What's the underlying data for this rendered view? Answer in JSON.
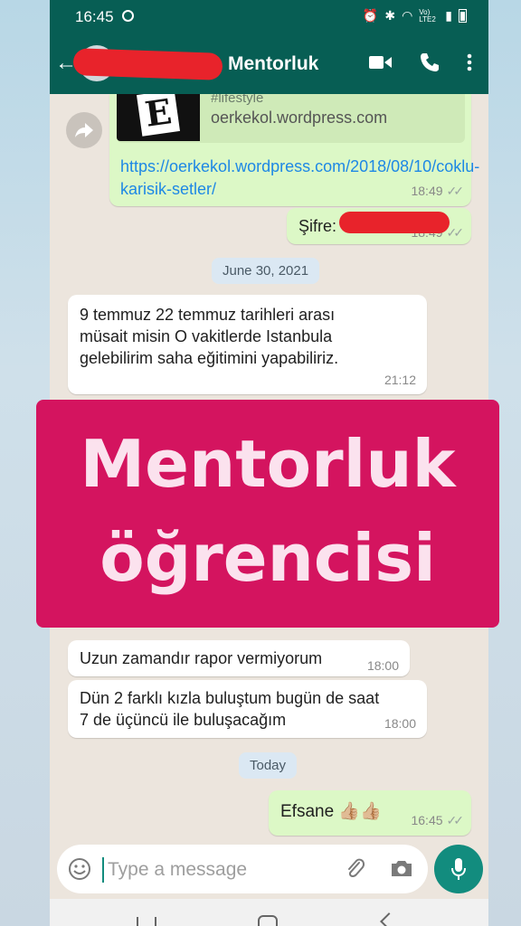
{
  "status_bar": {
    "time": "16:45",
    "icons": [
      "spotify-icon",
      "alarm-icon",
      "bluetooth-icon",
      "wifi-icon",
      "lte-icon",
      "signal-icon",
      "battery-icon"
    ],
    "lte_label": "Vo) LTE2"
  },
  "header": {
    "contact_name": "Mentorluk",
    "icons": [
      "back-arrow-icon",
      "video-call-icon",
      "voice-call-icon",
      "more-options-icon"
    ]
  },
  "messages": {
    "link_msg": {
      "preview_tag": "#lifestyle",
      "preview_site": "oerkekol.wordpress.com",
      "preview_thumb_letter": "E",
      "url": "https://oerkekol.wordpress.com/2018/08/10/coklu-karisik-setler/",
      "time": "18:49"
    },
    "password_msg": {
      "label": "Şifre:",
      "time": "18:49"
    },
    "date_chip_1": "June 30, 2021",
    "incoming_1": {
      "text": "9 temmuz 22 temmuz tarihleri arası müsait misin O vakitlerde Istanbula gelebilirim saha eğitimini yapabiliriz.",
      "time": "21:12"
    },
    "incoming_2": {
      "text": "Uzun zamandır rapor vermiyorum",
      "time": "18:00"
    },
    "incoming_3": {
      "text": "Dün  2 farklı kızla buluştum  bugün de saat 7 de üçüncü ile buluşacağım",
      "time": "18:00"
    },
    "date_chip_2": "Today",
    "outgoing_last": {
      "text": "Efsane 👍🏼👍🏼",
      "time": "16:45"
    }
  },
  "overlay": {
    "line1": "Mentorluk",
    "line2": "öğrencisi",
    "color": "#d4145f"
  },
  "input": {
    "placeholder": "Type a message"
  },
  "colors": {
    "header": "#075e54",
    "outgoing_bubble": "#dcf8c6",
    "chat_bg": "#ece5dd",
    "accent": "#128c7e"
  }
}
